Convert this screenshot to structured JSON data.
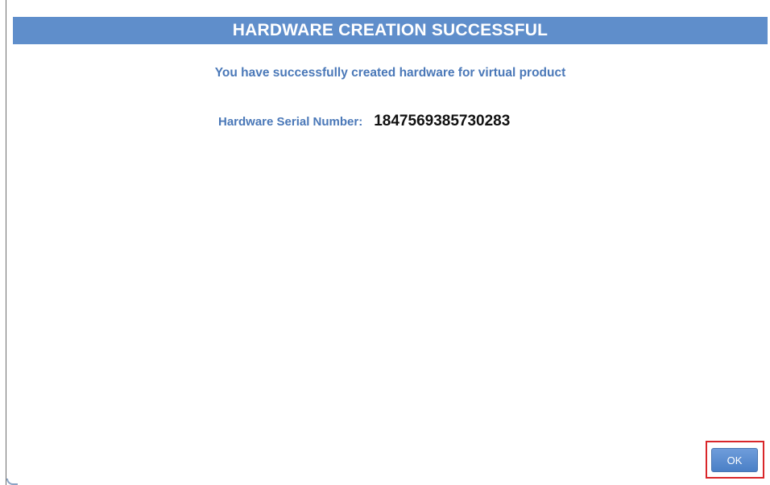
{
  "dialog": {
    "title": "HARDWARE CREATION SUCCESSFUL",
    "message": "You have successfully created hardware for virtual product",
    "serial_label": "Hardware Serial Number:",
    "serial_value": "1847569385730283",
    "ok_label": "OK"
  },
  "colors": {
    "title_bar": "#5f8ecb",
    "label_text": "#4a78b8",
    "highlight_box": "#d9262a"
  }
}
